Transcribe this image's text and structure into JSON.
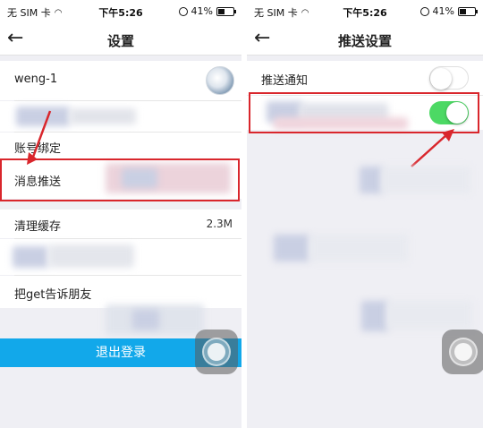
{
  "status_bar": {
    "carrier": "无 SIM 卡",
    "time": "下午5:26",
    "battery": "41%",
    "battery_level": 0.41
  },
  "left_screen": {
    "nav": {
      "back": "←",
      "title": "设置"
    },
    "rows": {
      "username": "weng-1",
      "account_binding": "账号绑定",
      "push_messages": "消息推送",
      "clear_cache": "清理缓存",
      "cache_size": "2.3M",
      "share": "把get告诉朋友"
    },
    "logout_label": "退出登录"
  },
  "right_screen": {
    "nav": {
      "back": "←",
      "title": "推送设置"
    },
    "push_notification_label": "推送通知",
    "push_notification_on": false,
    "second_toggle_on": true
  },
  "colors": {
    "accent_blue": "#12a8ea",
    "toggle_green": "#4cd964",
    "highlight_red": "#d9262c",
    "background": "#efeff4"
  }
}
